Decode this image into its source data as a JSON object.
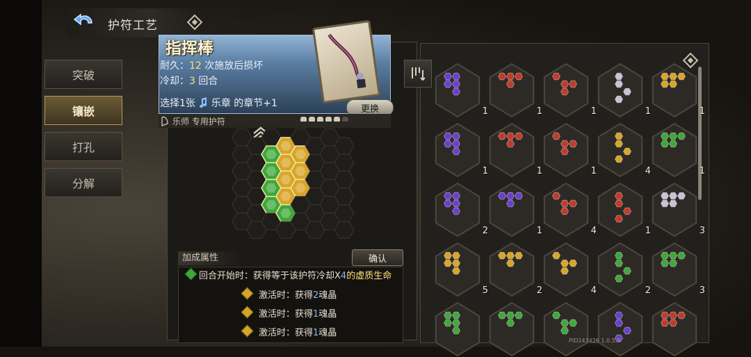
{
  "header": {
    "title": "护符工艺",
    "back_icon": "back-arrow-icon",
    "help_icon": "diamond-help-icon"
  },
  "sidebar": {
    "items": [
      {
        "label": "突破",
        "active": false
      },
      {
        "label": "镶嵌",
        "active": true
      },
      {
        "label": "打孔",
        "active": false
      },
      {
        "label": "分解",
        "active": false
      }
    ]
  },
  "card": {
    "name": "指挥棒",
    "durability_label": "耐久：",
    "durability_value": "12",
    "durability_suffix": " 次施放后损坏",
    "cooldown_label": "冷却：",
    "cooldown_value": "3",
    "cooldown_suffix": " 回合",
    "effect_prefix": "选择1张",
    "effect_keyword": "乐章",
    "effect_suffix": " 的章节+1",
    "swap_label": "更换",
    "owner": "乐师 专用护符",
    "quality_filled": 5,
    "quality_total": 6
  },
  "colors": {
    "gold": "#d8a526",
    "green": "#3fa83a",
    "purple": "#6a3fd0",
    "red": "#c23a2a",
    "silver": "#c8c2d8"
  },
  "socket_grid": {
    "gems": [
      {
        "col": 1,
        "row": 0,
        "color": "gold"
      },
      {
        "col": 0,
        "row": 1,
        "color": "green"
      },
      {
        "col": 1,
        "row": 1,
        "color": "gold"
      },
      {
        "col": 2,
        "row": 1,
        "color": "gold"
      },
      {
        "col": 0,
        "row": 2,
        "color": "green"
      },
      {
        "col": 1,
        "row": 2,
        "color": "gold"
      },
      {
        "col": 2,
        "row": 2,
        "color": "gold"
      },
      {
        "col": 0,
        "row": 3,
        "color": "green"
      },
      {
        "col": 1,
        "row": 3,
        "color": "gold"
      },
      {
        "col": 2,
        "row": 3,
        "color": "gold"
      },
      {
        "col": 0,
        "row": 4,
        "color": "green"
      },
      {
        "col": 1,
        "row": 4,
        "color": "green"
      }
    ]
  },
  "bonus": {
    "title": "加成属性",
    "confirm_label": "确认",
    "lines": [
      {
        "prefix": "回合开始时：获得等于该护符冷却X",
        "value": "4",
        "suffix": "的虚质生命"
      },
      {
        "prefix": "激活时：获得",
        "value": "2",
        "suffix": "魂晶"
      },
      {
        "prefix": "激活时：获得",
        "value": "1",
        "suffix": "魂晶"
      },
      {
        "prefix": "激活时：获得",
        "value": "1",
        "suffix": "魂晶"
      }
    ]
  },
  "inventory": {
    "items": [
      {
        "color": "purple",
        "count": "1"
      },
      {
        "color": "red",
        "count": "1"
      },
      {
        "color": "red",
        "count": "1"
      },
      {
        "color": "silver",
        "count": "1"
      },
      {
        "color": "gold",
        "count": "1"
      },
      {
        "color": "purple",
        "count": "1"
      },
      {
        "color": "red",
        "count": "1"
      },
      {
        "color": "red",
        "count": "1"
      },
      {
        "color": "gold",
        "count": "4"
      },
      {
        "color": "green",
        "count": "1"
      },
      {
        "color": "purple",
        "count": "2"
      },
      {
        "color": "purple",
        "count": "1"
      },
      {
        "color": "red",
        "count": "4"
      },
      {
        "color": "red",
        "count": "1"
      },
      {
        "color": "silver",
        "count": "3"
      },
      {
        "color": "gold",
        "count": "5"
      },
      {
        "color": "gold",
        "count": "2"
      },
      {
        "color": "gold",
        "count": "4"
      },
      {
        "color": "green",
        "count": "2"
      },
      {
        "color": "green",
        "count": "3"
      },
      {
        "color": "green",
        "count": ""
      },
      {
        "color": "green",
        "count": ""
      },
      {
        "color": "green",
        "count": ""
      },
      {
        "color": "purple",
        "count": ""
      },
      {
        "color": "red",
        "count": ""
      }
    ]
  },
  "version": "PID243426  1.0.5.8"
}
